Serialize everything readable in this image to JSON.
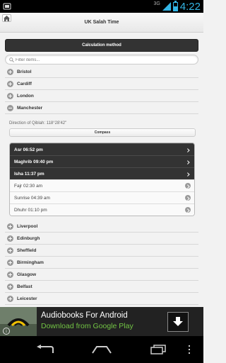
{
  "status_bar": {
    "network": "3G",
    "time": "4:22",
    "battery_level": 0.5
  },
  "header": {
    "title": "UK Salah Time"
  },
  "calc_button": {
    "label": "Calculation method"
  },
  "filter": {
    "placeholder": "Filter items..."
  },
  "cities_before": [
    "Bristol",
    "Cardiff",
    "London"
  ],
  "expanded_city": {
    "name": "Manchester",
    "qibla_direction": "Direction of Qiblah: 118°28'42\"",
    "compass_label": "Compass"
  },
  "prayers": [
    {
      "text": "Asr 06:52 pm",
      "style": "dark"
    },
    {
      "text": "Maghrib 09:40 pm",
      "style": "dark"
    },
    {
      "text": "Isha 11:37 pm",
      "style": "dark"
    },
    {
      "text": "Fajr 02:30 am",
      "style": "light"
    },
    {
      "text": "Sunrise 04:39 am",
      "style": "light"
    },
    {
      "text": "Dhuhr 01:10 pm",
      "style": "light"
    }
  ],
  "cities_after": [
    "Liverpool",
    "Edinburgh",
    "Sheffield",
    "Birmingham",
    "Glasgow",
    "Belfast",
    "Leicester"
  ],
  "ad": {
    "title": "Audiobooks For Android",
    "subtitle": "Download from Google Play",
    "info_label": "i"
  },
  "colors": {
    "accent": "#33b5e5",
    "dark_row": "#333333",
    "ad_green": "#72c444"
  }
}
